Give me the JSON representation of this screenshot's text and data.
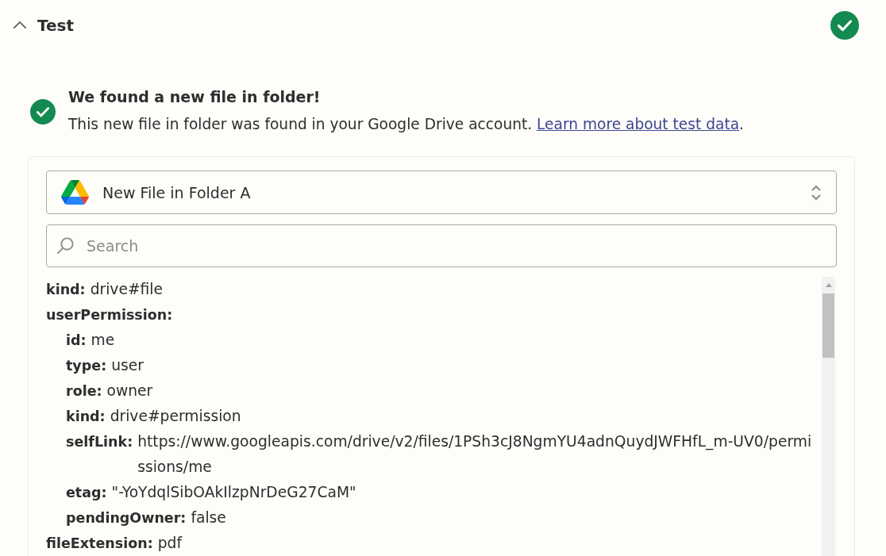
{
  "section": {
    "title": "Test",
    "expanded": true,
    "complete": true
  },
  "result": {
    "title": "We found a new file in folder!",
    "message": "This new file in folder was found in your Google Drive account.",
    "link": "Learn more about test data",
    "after_link": "."
  },
  "record_picker": {
    "value": "New File in Folder A"
  },
  "search": {
    "placeholder": "Search"
  },
  "fields": [
    {
      "key": "kind:",
      "value": "drive#file"
    },
    {
      "key": "userPermission:",
      "children": [
        {
          "key": "id:",
          "value": "me"
        },
        {
          "key": "type:",
          "value": "user"
        },
        {
          "key": "role:",
          "value": "owner"
        },
        {
          "key": "kind:",
          "value": "drive#permission"
        },
        {
          "key": "selfLink:",
          "value": "https://www.googleapis.com/drive/v2/files/1PSh3cJ8NgmYU4adnQuydJWFHfL_m-UV0/permissions/me"
        },
        {
          "key": "etag:",
          "value": "\"-YoYdqlSibOAkIlzpNrDeG27CaM\""
        },
        {
          "key": "pendingOwner:",
          "value": "false"
        }
      ]
    },
    {
      "key": "fileExtension:",
      "value": "pdf"
    }
  ]
}
